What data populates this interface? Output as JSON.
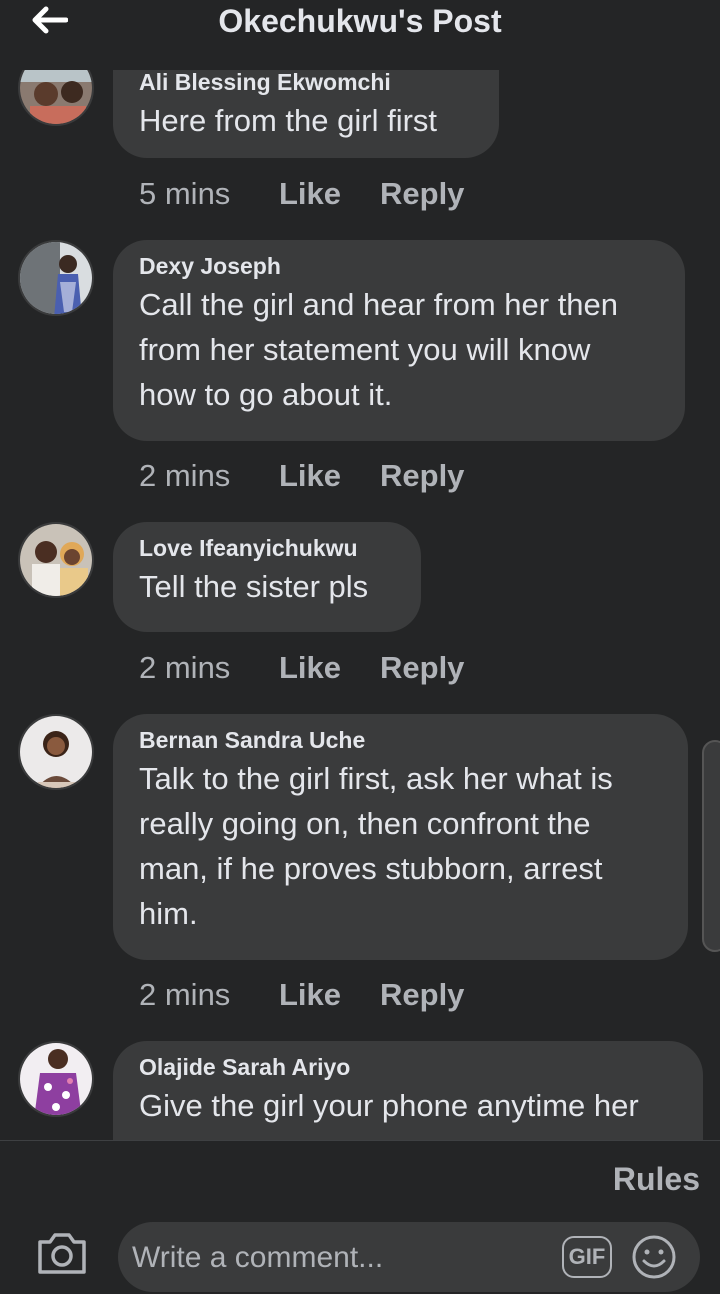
{
  "header": {
    "title": "Okechukwu's Post"
  },
  "comments": [
    {
      "author": "Ali Blessing Ekwomchi",
      "lines": [
        "Here from the girl first"
      ],
      "time": "5 mins",
      "like": "Like",
      "reply": "Reply"
    },
    {
      "author": "Dexy Joseph",
      "lines": [
        "Call the girl and hear from her then",
        "from her statement you will know",
        "how to go about it."
      ],
      "time": "2 mins",
      "like": "Like",
      "reply": "Reply"
    },
    {
      "author": "Love Ifeanyichukwu",
      "lines": [
        "Tell the sister pls"
      ],
      "time": "2 mins",
      "like": "Like",
      "reply": "Reply"
    },
    {
      "author": "Bernan Sandra Uche",
      "lines": [
        "Talk to the girl first, ask her what is",
        "really going on, then confront the",
        "man, if he proves stubborn, arrest",
        "him."
      ],
      "time": "2 mins",
      "like": "Like",
      "reply": "Reply"
    },
    {
      "author": "Olajide Sarah Ariyo",
      "lines": [
        "Give the girl your phone anytime her"
      ]
    }
  ],
  "footer": {
    "rules_label": "Rules",
    "comment_placeholder": "Write a comment...",
    "gif_label": "GIF"
  },
  "icons": {
    "back": "back-arrow-icon",
    "camera": "camera-icon",
    "emoji": "emoji-icon"
  },
  "colors": {
    "background": "#242526",
    "bubble": "#3a3b3c",
    "primary_text": "#e4e6eb",
    "secondary_text": "#b0b3b8"
  }
}
